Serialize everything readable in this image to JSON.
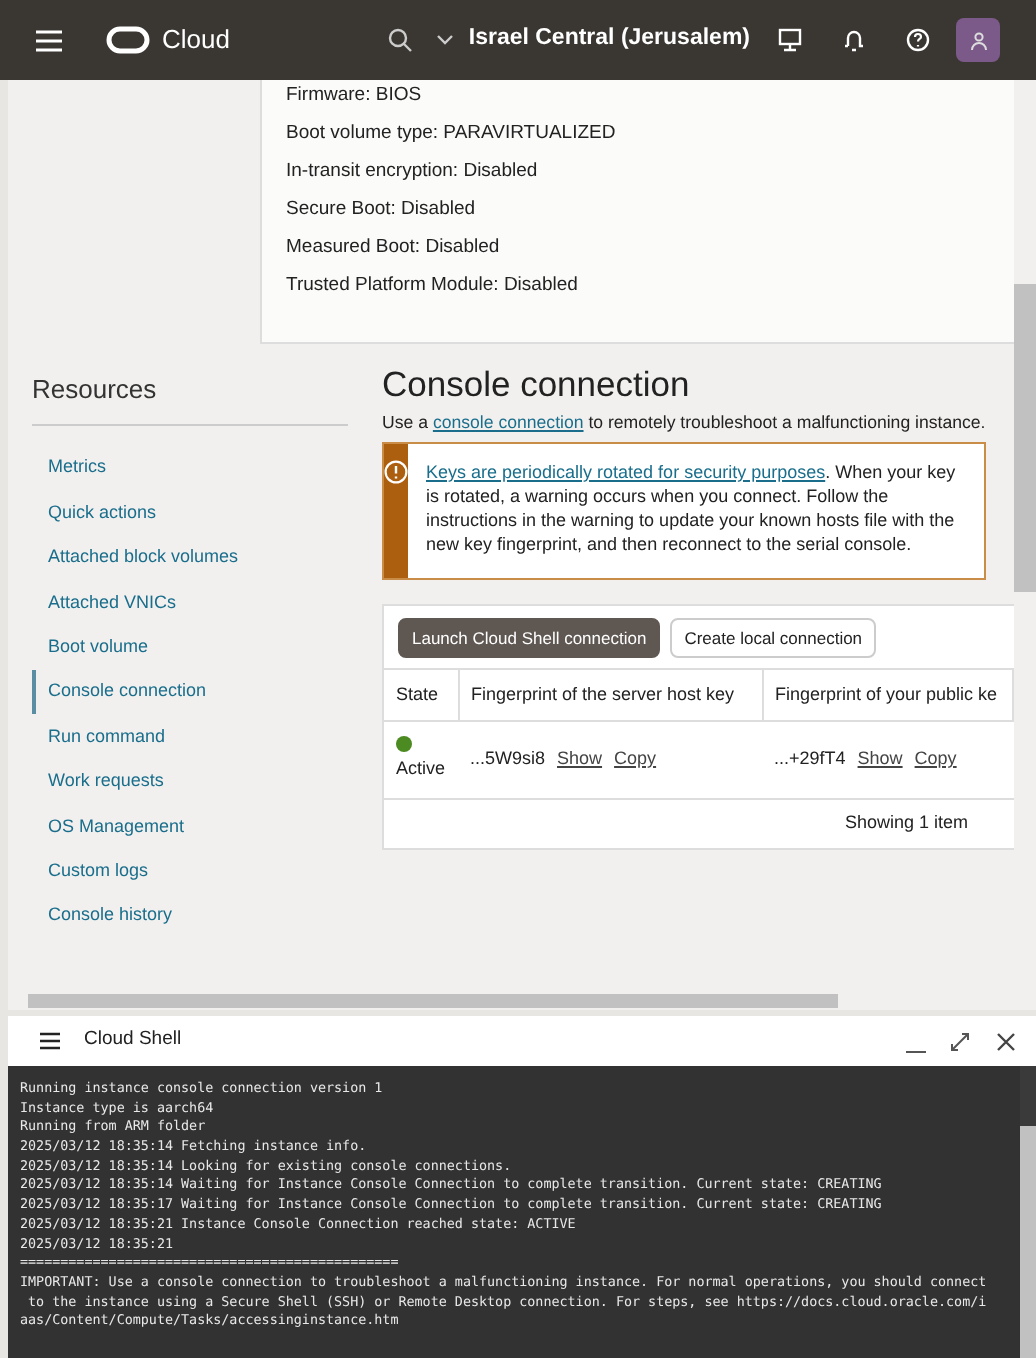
{
  "header": {
    "brand": "Cloud",
    "region": "Israel Central (Jerusalem)"
  },
  "details": [
    "Firmware: BIOS",
    "Boot volume type: PARAVIRTUALIZED",
    "In-transit encryption: Disabled",
    "Secure Boot: Disabled",
    "Measured Boot: Disabled",
    "Trusted Platform Module: Disabled"
  ],
  "resources": {
    "title": "Resources",
    "items": [
      {
        "label": "Metrics",
        "selected": false
      },
      {
        "label": "Quick actions",
        "selected": false
      },
      {
        "label": "Attached block volumes",
        "selected": false
      },
      {
        "label": "Attached VNICs",
        "selected": false
      },
      {
        "label": "Boot volume",
        "selected": false
      },
      {
        "label": "Console connection",
        "selected": true
      },
      {
        "label": "Run command",
        "selected": false
      },
      {
        "label": "Work requests",
        "selected": false
      },
      {
        "label": "OS Management",
        "selected": false
      },
      {
        "label": "Custom logs",
        "selected": false
      },
      {
        "label": "Console history",
        "selected": false
      }
    ]
  },
  "section": {
    "title": "Console connection",
    "intro_before": "Use a",
    "intro_link": "console connection",
    "intro_after": "to remotely troubleshoot a malfunctioning instance.",
    "warning_link": "Keys are periodically rotated for security purposes",
    "warning_text": ". When your key is rotated, a warning occurs when you connect. Follow the instructions in the warning to update your known hosts file with the new key fingerprint, and then reconnect to the serial console.",
    "buttons": [
      {
        "label": "Launch Cloud Shell connection",
        "kind": "primary"
      },
      {
        "label": "Create local connection",
        "kind": "secondary"
      }
    ],
    "table": {
      "columns": [
        "State",
        "Fingerprint of the server host key",
        "Fingerprint of your public ke"
      ],
      "rows": [
        {
          "state": "Active",
          "color": "#4c8a22",
          "server_key": "...5W9si8",
          "server_actions": [
            "Show",
            "Copy"
          ],
          "public_key": "...+29fT4",
          "public_actions": [
            "Show",
            "Copy"
          ]
        }
      ],
      "footer": "Showing 1 item"
    }
  },
  "cloud_shell": {
    "title": "Cloud Shell",
    "lines": [
      "Running instance console connection version 1",
      "Instance type is aarch64",
      "Running from ARM folder",
      "2025/03/12 18:35:14 Fetching instance info.",
      "2025/03/12 18:35:14 Looking for existing console connections.",
      "2025/03/12 18:35:14 Waiting for Instance Console Connection to complete transition. Current state: CREATING",
      "2025/03/12 18:35:17 Waiting for Instance Console Connection to complete transition. Current state: CREATING",
      "2025/03/12 18:35:21 Instance Console Connection reached state: ACTIVE",
      "2025/03/12 18:35:21",
      "===============================================",
      "IMPORTANT: Use a console connection to troubleshoot a malfunctioning instance. For normal operations, you should connect",
      " to the instance using a Secure Shell (SSH) or Remote Desktop connection. For steps, see https://docs.cloud.oracle.com/i",
      "aas/Content/Compute/Tasks/accessinginstance.htm"
    ]
  }
}
